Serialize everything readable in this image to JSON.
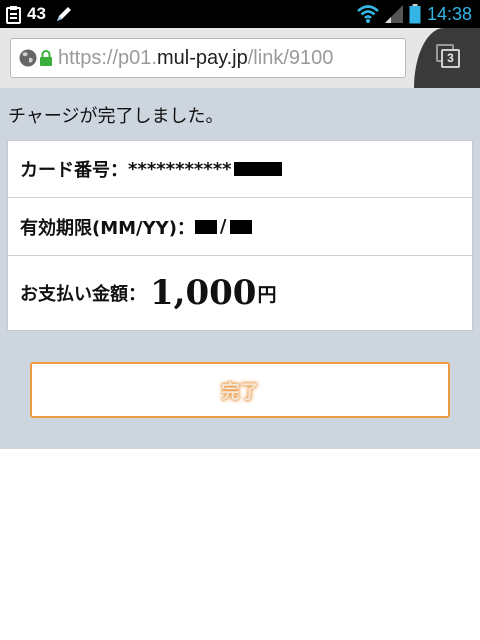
{
  "status_bar": {
    "notification_count": "43",
    "time": "14:38",
    "icons": [
      "clipboard-icon",
      "pen-icon",
      "wifi-icon",
      "signal-icon",
      "battery-icon"
    ],
    "time_color": "#33b5e5"
  },
  "browser": {
    "url_prefix": "https://p01.",
    "url_domain": "mul-pay.jp",
    "url_suffix": "/link/9100",
    "tab_count": "3",
    "icons": [
      "globe-icon",
      "lock-icon",
      "tabs-icon"
    ]
  },
  "page": {
    "message": "チャージが完了しました。",
    "card_number_label": "カード番号：",
    "card_number_value": "***********",
    "expiry_label": "有効期限(MM/YY)：",
    "expiry_separator": "/",
    "amount_label": "お支払い金額：",
    "amount_value": "1,000",
    "amount_unit": "円",
    "done_button": "完了",
    "colors": {
      "background": "#cdd5de",
      "button_border": "#f09a3e"
    }
  }
}
